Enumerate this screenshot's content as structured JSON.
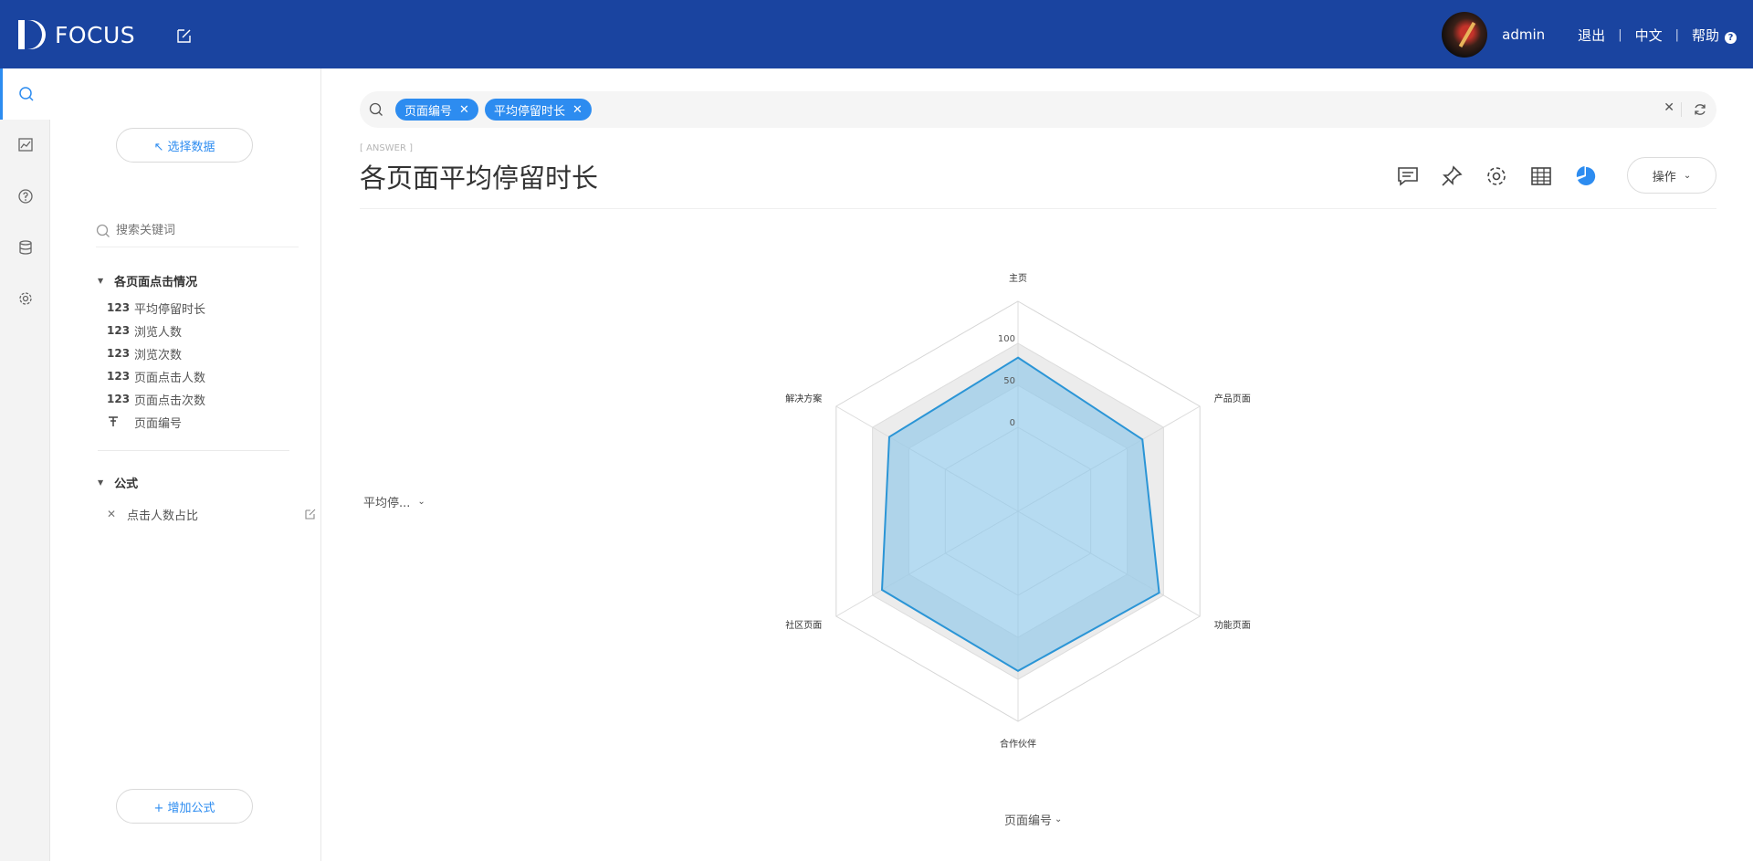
{
  "app": {
    "brand": "FOCUS"
  },
  "header": {
    "user_name": "admin",
    "logout": "退出",
    "language": "中文",
    "help": "帮助",
    "help_icon": "?"
  },
  "rail": {
    "items": [
      "search-icon",
      "chart-icon",
      "help-icon",
      "database-icon",
      "settings-icon"
    ]
  },
  "panel": {
    "select_data": "↖ 选择数据",
    "search_placeholder": "搜索关键词",
    "group_title": "各页面点击情况",
    "fields": [
      {
        "type": "123",
        "label": "平均停留时长"
      },
      {
        "type": "123",
        "label": "浏览人数"
      },
      {
        "type": "123",
        "label": "浏览次数"
      },
      {
        "type": "123",
        "label": "页面点击人数"
      },
      {
        "type": "123",
        "label": "页面点击次数"
      },
      {
        "type": "T",
        "label": "页面编号"
      }
    ],
    "formula_title": "公式",
    "formulas": [
      {
        "label": "点击人数占比"
      }
    ],
    "add_formula": "+ 增加公式"
  },
  "search": {
    "tags": [
      "页面编号",
      "平均停留时长"
    ]
  },
  "answer": {
    "label": "[ ANSWER ]",
    "title": "各页面平均停留时长",
    "ops_label": "操作"
  },
  "selectors": {
    "measure": "平均停...",
    "dimension": "页面编号"
  },
  "colors": {
    "header": "#1a44a0",
    "accent": "#2d8cf0",
    "area": "#8fc8ea",
    "line": "#2b95d6"
  },
  "chart_data": {
    "type": "radar",
    "categories": [
      "主页",
      "产品页面",
      "功能页面",
      "合作伙伴",
      "社区页面",
      "解决方案"
    ],
    "values": [
      83,
      71,
      94,
      90,
      87,
      77
    ],
    "radial_ticks": [
      "0",
      "50",
      "100"
    ],
    "radial_min": -100,
    "radial_max": 150
  }
}
